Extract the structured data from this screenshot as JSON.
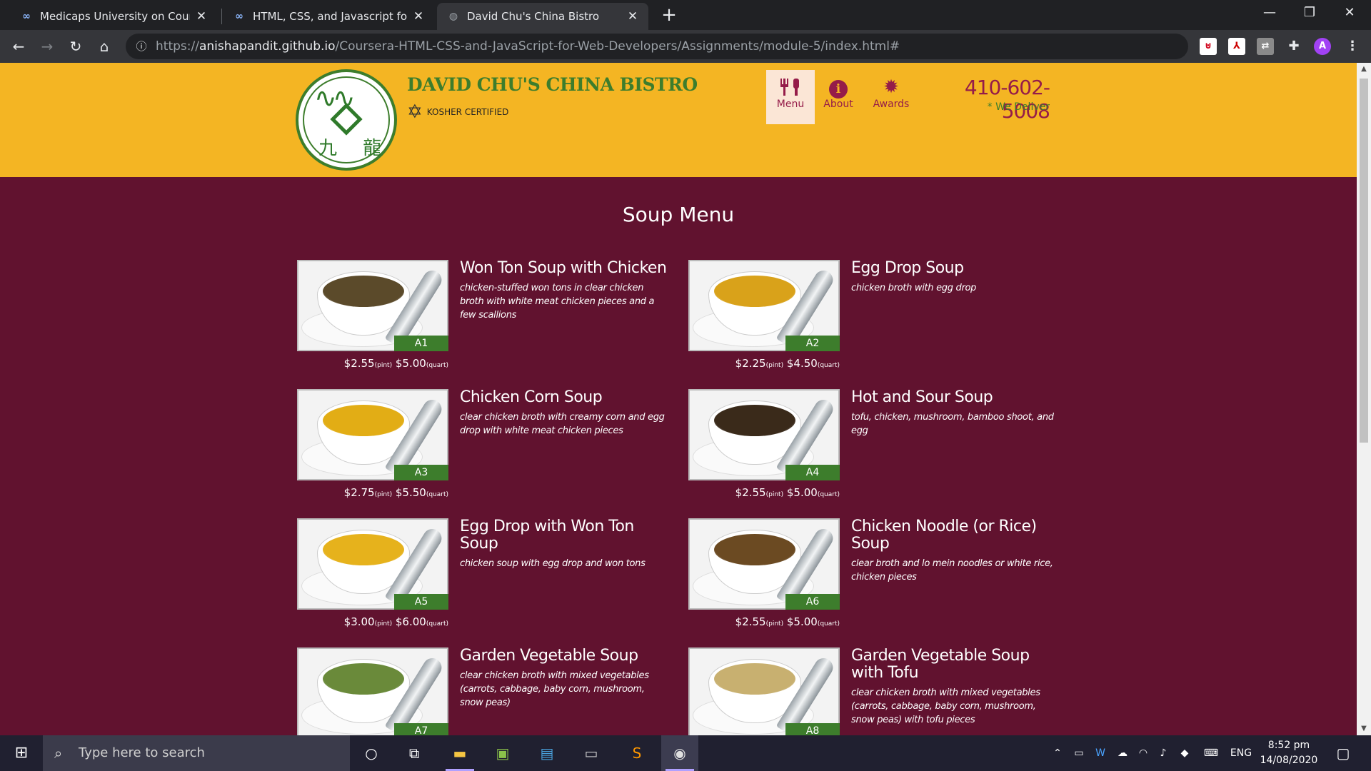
{
  "browser": {
    "tabs": [
      {
        "title": "Medicaps University on Coursera",
        "favicon": "coursera-icon",
        "active": false
      },
      {
        "title": "HTML, CSS, and Javascript for Web Developers",
        "favicon": "coursera-icon",
        "active": false
      },
      {
        "title": "David Chu's China Bistro",
        "favicon": "globe-icon",
        "active": true
      }
    ],
    "new_tab": "+",
    "url_prefix": "https://",
    "url_host": "anishapandit.github.io",
    "url_path": "/Coursera-HTML-CSS-and-JavaScript-for-Web-Developers/Assignments/module-5/index.html#",
    "profile_initial": "A"
  },
  "header": {
    "restaurant_name": "DAVID CHU'S CHINA BISTRO",
    "kosher": "KOSHER CERTIFIED",
    "logo_characters": "九 龍",
    "nav": [
      {
        "label": "Menu",
        "icon": "utensils-icon",
        "active": true
      },
      {
        "label": "About",
        "icon": "info-icon",
        "active": false
      },
      {
        "label": "Awards",
        "icon": "certificate-icon",
        "active": false
      }
    ],
    "phone": "410-602-5008",
    "deliver": "* We Deliver"
  },
  "page": {
    "title": "Soup Menu"
  },
  "menu_items": [
    {
      "code": "A1",
      "name": "Won Ton Soup with Chicken",
      "description": "chicken-stuffed won tons in clear chicken broth with white meat chicken pieces and a few scallions",
      "price_pint": "$2.55",
      "price_quart": "$5.00",
      "soup_color": "#5b4a2a"
    },
    {
      "code": "A2",
      "name": "Egg Drop Soup",
      "description": "chicken broth with egg drop",
      "price_pint": "$2.25",
      "price_quart": "$4.50",
      "soup_color": "#d9a21a"
    },
    {
      "code": "A3",
      "name": "Chicken Corn Soup",
      "description": "clear chicken broth with creamy corn and egg drop with white meat chicken pieces",
      "price_pint": "$2.75",
      "price_quart": "$5.50",
      "soup_color": "#e2ad15"
    },
    {
      "code": "A4",
      "name": "Hot and Sour Soup",
      "description": "tofu, chicken, mushroom, bamboo shoot, and egg",
      "price_pint": "$2.55",
      "price_quart": "$5.00",
      "soup_color": "#3a2a1a"
    },
    {
      "code": "A5",
      "name": "Egg Drop with Won Ton Soup",
      "description": "chicken soup with egg drop and won tons",
      "price_pint": "$3.00",
      "price_quart": "$6.00",
      "soup_color": "#e6b21c"
    },
    {
      "code": "A6",
      "name": "Chicken Noodle (or Rice) Soup",
      "description": "clear broth and lo mein noodles or white rice, chicken pieces",
      "price_pint": "$2.55",
      "price_quart": "$5.00",
      "soup_color": "#6b4a22"
    },
    {
      "code": "A7",
      "name": "Garden Vegetable Soup",
      "description": "clear chicken broth with mixed vegetables (carrots, cabbage, baby corn, mushroom, snow peas)",
      "price_pint": "",
      "price_quart": "",
      "soup_color": "#6a8a3a"
    },
    {
      "code": "A8",
      "name": "Garden Vegetable Soup with Tofu",
      "description": "clear chicken broth with mixed vegetables (carrots, cabbage, baby corn, mushroom, snow peas) with tofu pieces",
      "price_pint": "",
      "price_quart": "",
      "soup_color": "#c8b070"
    }
  ],
  "price_units": {
    "pint": "(pint)",
    "quart": "(quart)"
  },
  "taskbar": {
    "search_placeholder": "Type here to search",
    "language": "ENG",
    "time": "8:52 pm",
    "date": "14/08/2020"
  },
  "colors": {
    "header_bg": "#f4b523",
    "page_bg": "#61122f",
    "accent_green": "#3d7d2c",
    "accent_maroon": "#951c49"
  }
}
